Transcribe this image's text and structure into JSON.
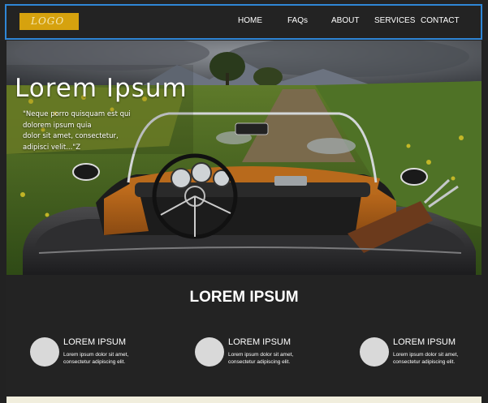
{
  "header": {
    "logo": "LOGO",
    "nav": [
      {
        "label": "HOME"
      },
      {
        "label": "FAQs"
      },
      {
        "label": "ABOUT"
      },
      {
        "label": "SERVICES"
      },
      {
        "label": "CONTACT"
      }
    ],
    "frame_color": "#2f86d6",
    "logo_color": "#d6a20e"
  },
  "hero": {
    "title": "Lorem Ipsum",
    "quote_lines": [
      "\"Neque porro quisquam est qui",
      "dolorem ipsum quia",
      "dolor sit amet, consectetur,",
      "adipisci velit...\"Z"
    ],
    "image": "vintage-convertible-car-in-field"
  },
  "section": {
    "title": "LOREM IPSUM",
    "features": [
      {
        "title": "LOREM IPSUM",
        "text_lines": [
          "Lorem ipsum dolor sit amet,",
          "consectetur adipiscing elit."
        ]
      },
      {
        "title": "LOREM IPSUM",
        "text_lines": [
          "Lorem ipsum dolor sit amet,",
          "consectetur adipiscing elit."
        ]
      },
      {
        "title": "LOREM IPSUM",
        "text_lines": [
          "Lorem ipsum dolor sit amet,",
          "consectetur adipiscing elit."
        ]
      }
    ]
  }
}
